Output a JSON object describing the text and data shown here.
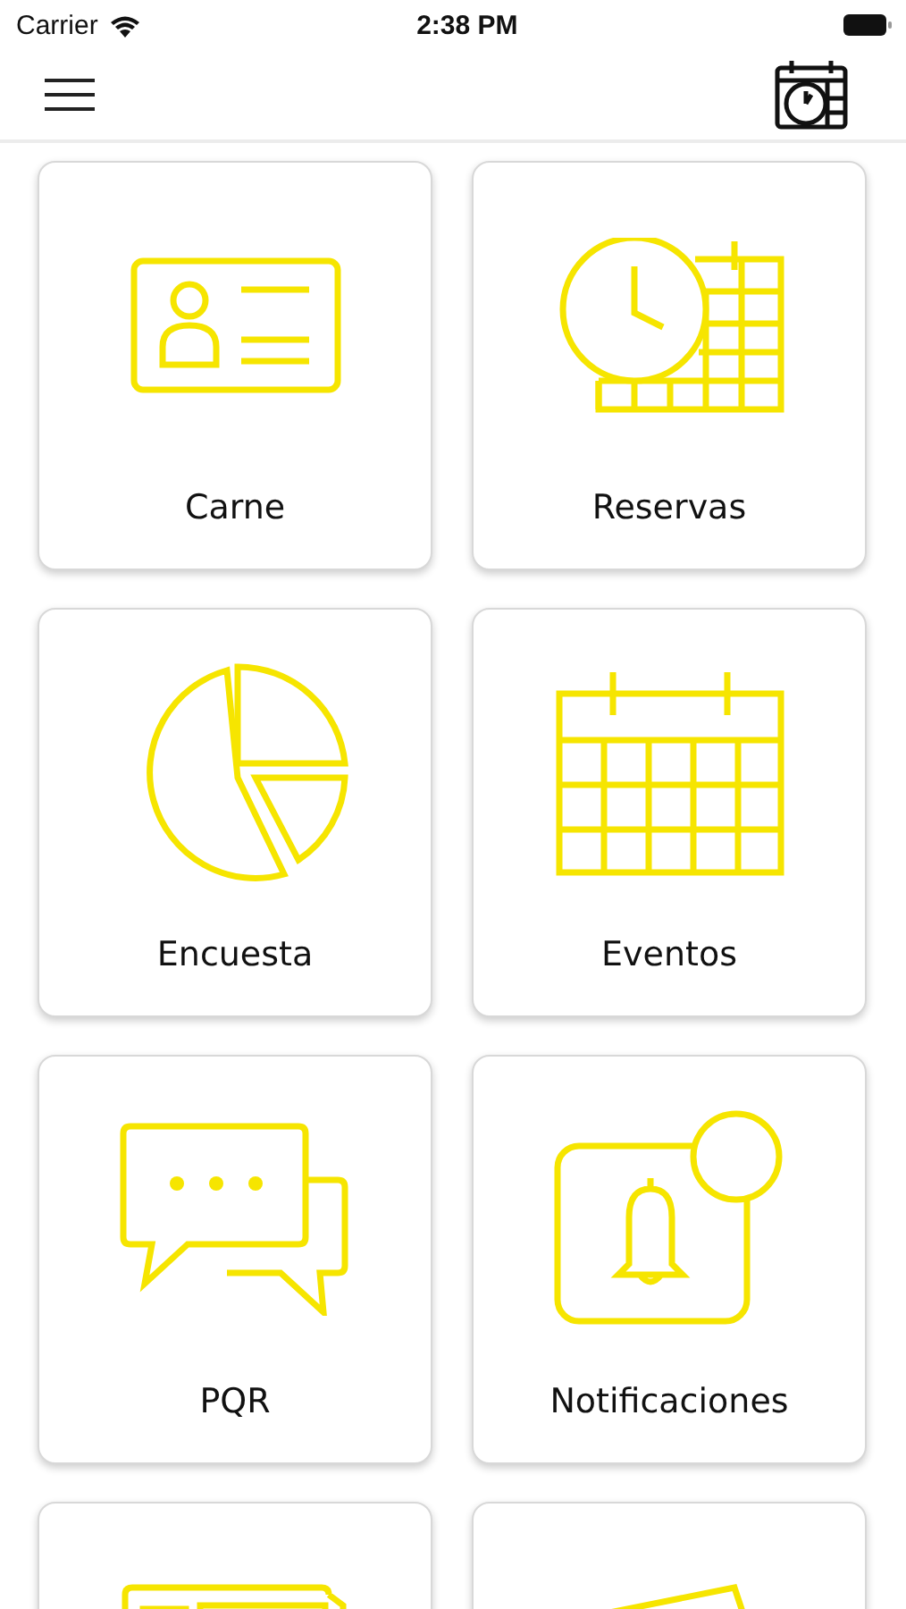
{
  "status_bar": {
    "carrier": "Carrier",
    "time": "2:38 PM"
  },
  "tiles": [
    {
      "kind": "id-card",
      "label": "Carne"
    },
    {
      "kind": "clock-calendar",
      "label": "Reservas"
    },
    {
      "kind": "pie",
      "label": "Encuesta"
    },
    {
      "kind": "calendar",
      "label": "Eventos"
    },
    {
      "kind": "chat",
      "label": "PQR"
    },
    {
      "kind": "bell",
      "label": "Notificaciones"
    },
    {
      "kind": "cards"
    },
    {
      "kind": "ticket"
    }
  ]
}
